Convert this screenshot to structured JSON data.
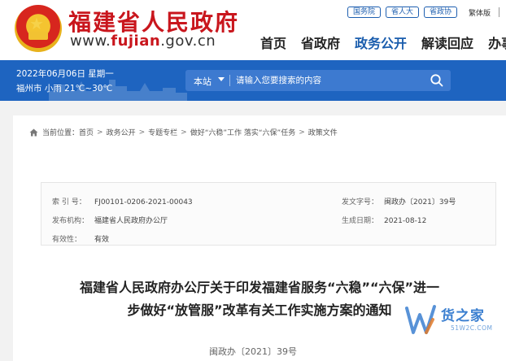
{
  "header": {
    "site_title": "福建省人民政府",
    "url_prefix": "www.",
    "url_brand": "fujian",
    "url_suffix": ".gov.cn",
    "top_links": [
      "国务院",
      "省人大",
      "省政协"
    ],
    "language_toggle": "繁体版",
    "nav": [
      {
        "label": "首页",
        "active": false
      },
      {
        "label": "省政府",
        "active": false
      },
      {
        "label": "政务公开",
        "active": true
      },
      {
        "label": "解读回应",
        "active": false
      },
      {
        "label": "办事",
        "active": false
      }
    ]
  },
  "infobar": {
    "date": "2022年06月06日 星期一",
    "weather": "福州市 小雨 21℃~30℃"
  },
  "search": {
    "scope": "本站",
    "placeholder": "请输入您要搜索的内容",
    "icon": "search-icon"
  },
  "breadcrumb": {
    "prefix": "当前位置：",
    "items": [
      "首页",
      "政务公开",
      "专题专栏",
      "做好“六稳”工作 落实“六保”任务",
      "政策文件"
    ],
    "separator": ">"
  },
  "document_meta": {
    "index_label": "索 引 号：",
    "index_value": "FJ00101-0206-2021-00043",
    "issue_no_label": "发文字号：",
    "issue_no_value": "闽政办〔2021〕39号",
    "publisher_label": "发布机构：",
    "publisher_value": "福建省人民政府办公厅",
    "date_label": "生成日期：",
    "date_value": "2021-08-12",
    "validity_label": "有效性：",
    "validity_value": "有效"
  },
  "document": {
    "title_line1": "福建省人民政府办公厅关于印发福建省服务“六稳”“六保”进一",
    "title_line2": "步做好“放管服”改革有关工作实施方案的通知",
    "number": "闽政办〔2021〕39号"
  },
  "watermark": {
    "text": "货之家",
    "url": "51W2C.COM"
  },
  "colors": {
    "brand_red": "#c9161d",
    "nav_blue": "#1a5dad",
    "bar_blue": "#1e64c0"
  }
}
